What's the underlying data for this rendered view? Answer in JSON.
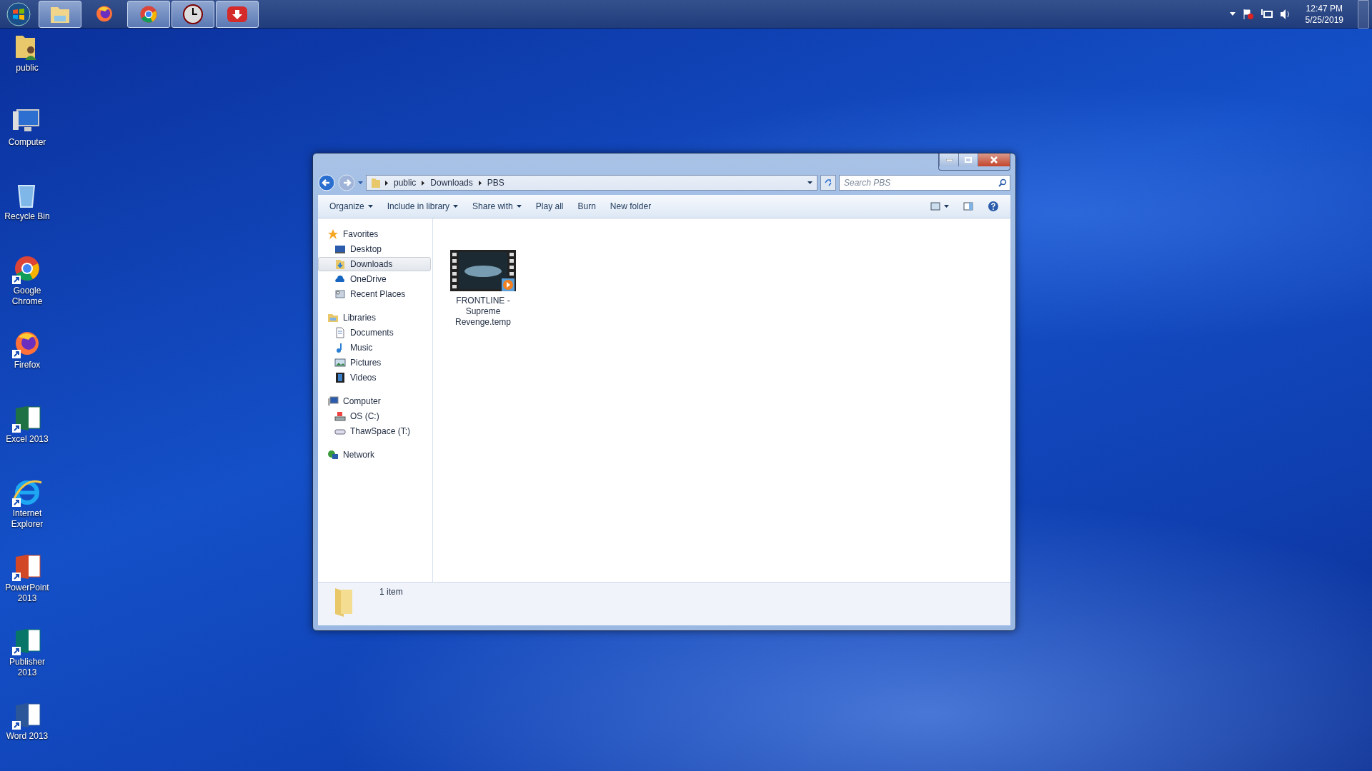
{
  "taskbar": {
    "buttons": [
      {
        "kind": "start"
      },
      {
        "kind": "explorer",
        "open": true
      },
      {
        "kind": "firefox",
        "open": false
      },
      {
        "kind": "chrome",
        "open": true
      },
      {
        "kind": "clock",
        "open": true
      },
      {
        "kind": "download",
        "open": true
      }
    ],
    "tray": {
      "time": "12:47 PM",
      "date": "5/25/2019"
    }
  },
  "desktop_icons": [
    {
      "label": "public",
      "kind": "user-folder"
    },
    {
      "label": "Computer",
      "kind": "computer"
    },
    {
      "label": "Recycle Bin",
      "kind": "bin"
    },
    {
      "label": "Google Chrome",
      "kind": "chrome"
    },
    {
      "label": "Firefox",
      "kind": "firefox"
    },
    {
      "label": "Excel 2013",
      "kind": "excel"
    },
    {
      "label": "Internet Explorer",
      "kind": "ie"
    },
    {
      "label": "PowerPoint 2013",
      "kind": "powerpoint"
    },
    {
      "label": "Publisher 2013",
      "kind": "publisher"
    },
    {
      "label": "Word 2013",
      "kind": "word"
    }
  ],
  "window": {
    "address": [
      "public",
      "Downloads",
      "PBS"
    ],
    "search": {
      "placeholder": "Search PBS"
    },
    "toolbar": [
      {
        "label": "Organize",
        "has_menu": true
      },
      {
        "label": "Include in library",
        "has_menu": true
      },
      {
        "label": "Share with",
        "has_menu": true
      },
      {
        "label": "Play all",
        "has_menu": false
      },
      {
        "label": "Burn",
        "has_menu": false
      },
      {
        "label": "New folder",
        "has_menu": false
      }
    ],
    "navigation": [
      {
        "label": "Favorites",
        "kind": "star",
        "selected": false,
        "children": [
          {
            "label": "Desktop",
            "kind": "desktop",
            "selected": false
          },
          {
            "label": "Downloads",
            "kind": "downloads",
            "selected": true
          },
          {
            "label": "OneDrive",
            "kind": "cloud",
            "selected": false
          },
          {
            "label": "Recent Places",
            "kind": "recent",
            "selected": false
          }
        ]
      },
      {
        "label": "Libraries",
        "kind": "library",
        "selected": false,
        "children": [
          {
            "label": "Documents",
            "kind": "document",
            "selected": false
          },
          {
            "label": "Music",
            "kind": "music",
            "selected": false
          },
          {
            "label": "Pictures",
            "kind": "pictures",
            "selected": false
          },
          {
            "label": "Videos",
            "kind": "videos",
            "selected": false
          }
        ]
      },
      {
        "label": "Computer",
        "kind": "computer",
        "selected": false,
        "children": [
          {
            "label": "OS (C:)",
            "kind": "os-drive",
            "selected": false
          },
          {
            "label": "ThawSpace (T:)",
            "kind": "drive",
            "selected": false
          }
        ]
      },
      {
        "label": "Network",
        "kind": "network",
        "selected": false
      }
    ],
    "files": [
      {
        "name": "FRONTLINE - Supreme Revenge.temp",
        "selected": false
      }
    ],
    "status": "1 item"
  }
}
